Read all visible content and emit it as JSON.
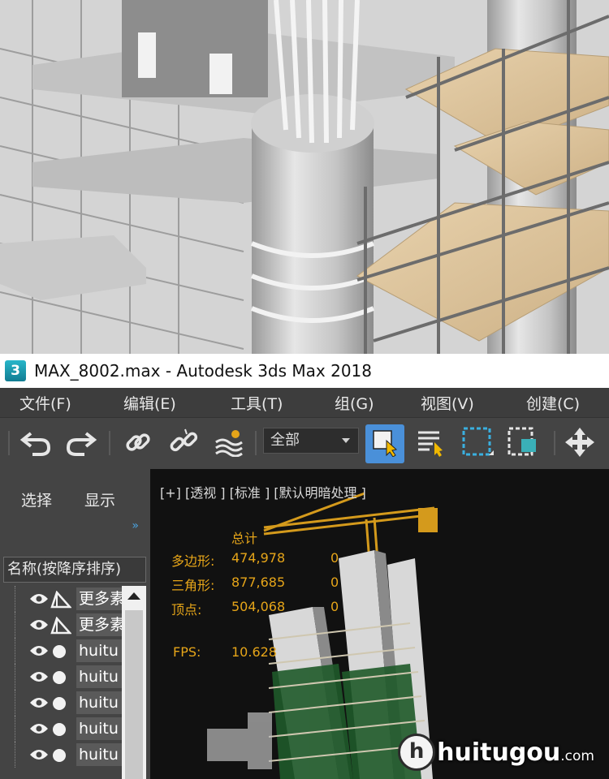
{
  "window": {
    "app_icon_text": "3",
    "title": "MAX_8002.max - Autodesk 3ds Max 2018"
  },
  "menu": {
    "items": [
      {
        "label": "文件(F)"
      },
      {
        "label": "编辑(E)"
      },
      {
        "label": "工具(T)"
      },
      {
        "label": "组(G)"
      },
      {
        "label": "视图(V)"
      },
      {
        "label": "创建(C)"
      }
    ]
  },
  "toolbar": {
    "icons": [
      "undo-icon",
      "redo-icon",
      "link-icon",
      "unlink-icon",
      "bind-space-warp-icon",
      "select-object-icon",
      "select-by-name-icon",
      "rect-selection-region-icon",
      "window-crossing-icon",
      "move-icon"
    ],
    "selection_filter": "全部",
    "accent": "#4a90d9"
  },
  "scene_explorer": {
    "tabs": [
      "选择",
      "显示"
    ],
    "column_header": "名称(按降序排序)",
    "rows": [
      {
        "name": "更多素",
        "icon": "light-icon"
      },
      {
        "name": "更多素",
        "icon": "light-icon"
      },
      {
        "name": "huitu",
        "icon": "sphere-icon"
      },
      {
        "name": "huitu",
        "icon": "sphere-icon"
      },
      {
        "name": "huitu",
        "icon": "sphere-icon"
      },
      {
        "name": "huitu",
        "icon": "sphere-icon"
      },
      {
        "name": "huitu",
        "icon": "sphere-icon"
      }
    ]
  },
  "viewport": {
    "label": "[+] [透视 ] [标准 ] [默认明暗处理 ]",
    "stats": {
      "header": "总计",
      "polygons_label": "多边形:",
      "polygons": "474,978",
      "triangles_label": "三角形:",
      "triangles": "877,685",
      "vertices_label": "顶点:",
      "vertices": "504,068",
      "fps_label": "FPS:",
      "fps": "10.628",
      "col2_values": [
        "0",
        "0",
        "0"
      ],
      "color": "#e6a519"
    }
  },
  "watermark": {
    "logo": "h",
    "text": "huitugou",
    "suffix": ".com"
  }
}
